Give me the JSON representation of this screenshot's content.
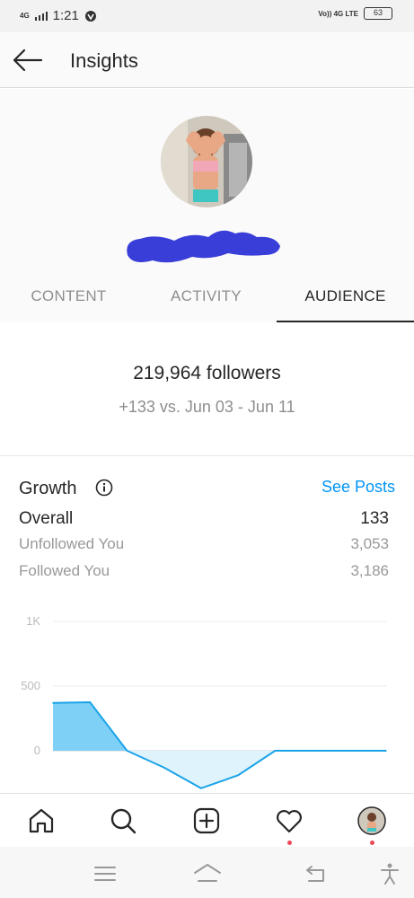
{
  "status_bar": {
    "network": "4G",
    "time": "1:21",
    "carrier_right": "Vo)) 4G LTE",
    "battery": "63"
  },
  "header": {
    "title": "Insights"
  },
  "tabs": [
    {
      "label": "CONTENT",
      "active": false
    },
    {
      "label": "ACTIVITY",
      "active": false
    },
    {
      "label": "AUDIENCE",
      "active": true
    }
  ],
  "summary": {
    "followers": "219,964 followers",
    "comparison": "+133 vs. Jun 03 - Jun 11"
  },
  "growth": {
    "title": "Growth",
    "see_posts": "See Posts",
    "overall_label": "Overall",
    "overall_value": "133",
    "unfollowed_label": "Unfollowed You",
    "unfollowed_value": "3,053",
    "followed_label": "Followed You",
    "followed_value": "3,186"
  },
  "chart_data": {
    "type": "area",
    "ytick_labels": [
      "1K",
      "500",
      "0"
    ],
    "yticks": [
      1000,
      500,
      0
    ],
    "ylim": [
      -300,
      1000
    ],
    "x": [
      0,
      1,
      2,
      3,
      4,
      5,
      6,
      7,
      8,
      9
    ],
    "series": [
      {
        "values": [
          370,
          375,
          0,
          -130,
          -290,
          -190,
          0,
          0,
          0,
          0
        ]
      }
    ],
    "grid": true,
    "colors": {
      "positive": "#7fd0f7",
      "negative": "#dff3fc",
      "line": "#1aa3e8"
    }
  },
  "bottom_nav": {
    "icons": [
      "home-icon",
      "search-icon",
      "new-post-icon",
      "activity-heart-icon",
      "profile-avatar"
    ]
  },
  "system_nav": {
    "icons": [
      "menu-icon",
      "home-outline-icon",
      "back-icon",
      "accessibility-icon"
    ]
  }
}
